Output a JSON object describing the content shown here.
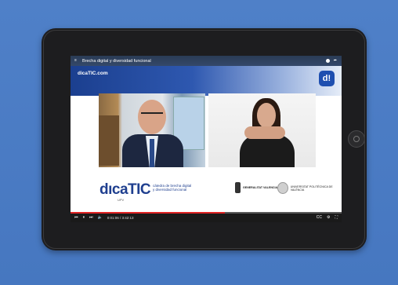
{
  "video": {
    "title": "Brecha digital y diversidad funcional",
    "site": "dicaTIC.com",
    "corner_logo": "d!",
    "brand": "dıcaTIC",
    "brand_sub": "UPV",
    "brand_desc": "càtedra de brecha digital y diversidad funcional",
    "sponsor1": "GENERALITAT VALENCIANA",
    "sponsor2": "UNIVERSITAT POLITÈCNICA DE VALÈNCIA",
    "time": "0:01:06 / 3:42:13",
    "progress": 0.57
  },
  "icons": {
    "top_left": "menu-icon",
    "top_right_1": "clock-icon",
    "top_right_2": "share-icon",
    "prev": "skip-back-icon",
    "pause": "pause-icon",
    "next": "skip-forward-icon",
    "volume": "volume-icon",
    "cc": "captions-icon",
    "settings": "gear-icon",
    "fullscreen": "fullscreen-icon"
  },
  "colors": {
    "background": "#4a7bc3",
    "brand_blue": "#1f3f8f",
    "progress": "#e02424"
  }
}
